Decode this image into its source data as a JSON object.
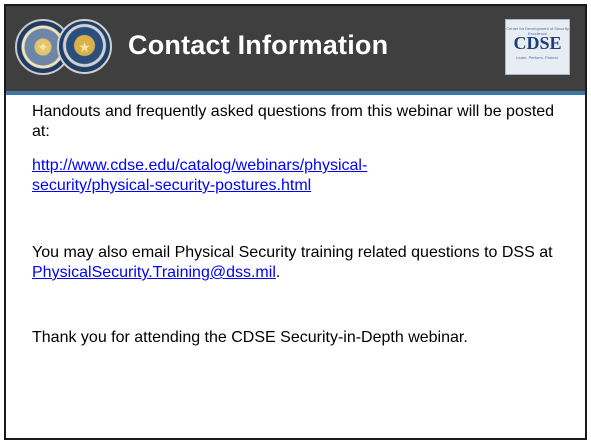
{
  "header": {
    "title": "Contact Information",
    "logo": {
      "tagline_top": "Center for Development of Security Excellence",
      "text": "CDSE",
      "tagline_bottom": "Learn. Perform. Protect."
    },
    "seals": [
      "dod-seal-icon",
      "dss-seal-icon"
    ]
  },
  "content": {
    "para1": "Handouts and frequently asked questions from this webinar will be posted at:",
    "link1_line1": "http://www.cdse.edu/catalog/webinars/physical-",
    "link1_line2": "security/physical-security-postures.html",
    "para3_prefix": "You may also email Physical Security training related questions to DSS at ",
    "email": "PhysicalSecurity.Training@dss.mil",
    "para3_suffix": ".",
    "para4": "Thank you for attending the CDSE Security-in-Depth webinar."
  },
  "colors": {
    "header_background": "#3f3f3f",
    "header_accent_line": "#3d76a8",
    "title_text": "#ffffff",
    "link": "#0000ff",
    "slide_border": "#1a1a1a"
  }
}
